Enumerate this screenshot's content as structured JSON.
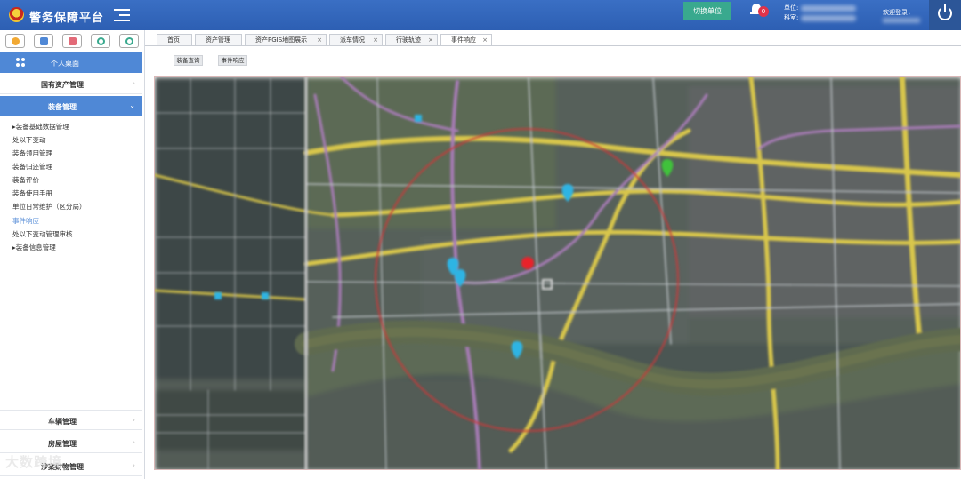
{
  "header": {
    "app_title": "警务保障平台",
    "switch_unit_label": "切换单位",
    "notification_count": "0",
    "unit_label": "单位:",
    "dept_label": "科室:",
    "welcome_text": "欢迎登录，"
  },
  "sidebar": {
    "quick_icons": [
      {
        "name": "money-bag-icon",
        "color": "#f2a933"
      },
      {
        "name": "card-icon",
        "color": "#4f88d6"
      },
      {
        "name": "toolbox-icon",
        "color": "#e36a78"
      },
      {
        "name": "recycle-icon",
        "color": "#39a98e"
      },
      {
        "name": "refresh-icon",
        "color": "#39a98e"
      }
    ],
    "desktop_label": "个人桌面",
    "groups_top": [
      {
        "label": "国有资产管理",
        "active": false
      },
      {
        "label": "装备管理",
        "active": true
      }
    ],
    "equipment_items": [
      {
        "label": "▸装备基础数据管理",
        "current": false
      },
      {
        "label": "处以下变动",
        "current": false
      },
      {
        "label": "装备领用管理",
        "current": false
      },
      {
        "label": "装备归还管理",
        "current": false
      },
      {
        "label": "装备评价",
        "current": false
      },
      {
        "label": "装备使用手册",
        "current": false
      },
      {
        "label": "单位日常维护（区分局）",
        "current": false
      },
      {
        "label": "事件响应",
        "current": true
      },
      {
        "label": "处以下变动管理审核",
        "current": false
      },
      {
        "label": "▸装备信息管理",
        "current": false
      }
    ],
    "groups_bottom": [
      {
        "label": "车辆管理"
      },
      {
        "label": "房屋管理"
      },
      {
        "label": "涉案财物管理"
      }
    ]
  },
  "tabs": [
    {
      "label": "首页",
      "closable": false,
      "active": false
    },
    {
      "label": "资产管理",
      "closable": false,
      "active": false
    },
    {
      "label": "资产PGIS地图展示",
      "closable": true,
      "active": false
    },
    {
      "label": "派车情况",
      "closable": true,
      "active": false
    },
    {
      "label": "行驶轨迹",
      "closable": true,
      "active": false
    },
    {
      "label": "事件响应",
      "closable": true,
      "active": true
    }
  ],
  "toolbar": {
    "equipment_query_label": "装备查询",
    "event_response_label": "事件响应"
  },
  "map": {
    "markers": [
      {
        "name": "map-marker-cyan",
        "color": "#2fb4e3"
      },
      {
        "name": "map-marker-green",
        "color": "#3fc23a"
      },
      {
        "name": "map-marker-red",
        "color": "#e8232a"
      }
    ],
    "radius_circle_color": "#c83a3a"
  },
  "watermark": "大数跨境"
}
